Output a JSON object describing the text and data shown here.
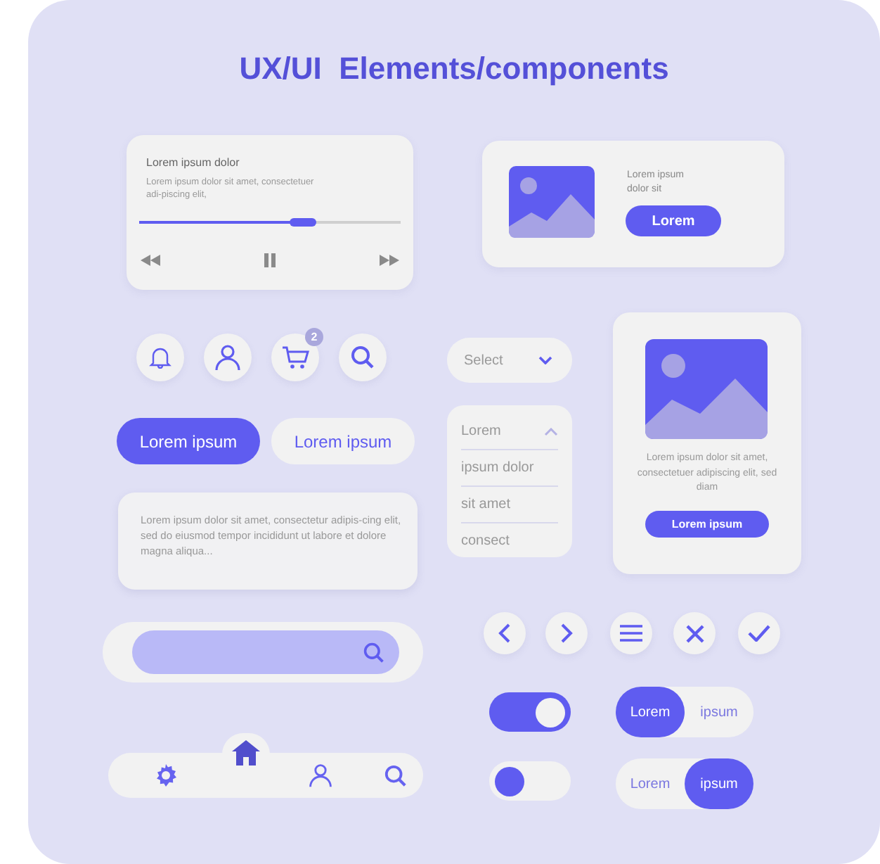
{
  "title": "UX/UI  Elements/components",
  "player": {
    "title": "Lorem ipsum dolor",
    "text": "Lorem ipsum dolor sit amet, consectetuer adi-piscing elit,",
    "level": 0.63
  },
  "media_card": {
    "text": "Lorem ipsum dolor sit",
    "button": "Lorem"
  },
  "cart_badge": "2",
  "buttons": [
    {
      "label": "Lorem ipsum",
      "kind": "primary"
    },
    {
      "label": "Lorem ipsum",
      "kind": "secondary"
    }
  ],
  "text_box": {
    "text": "Lorem ipsum dolor sit amet, consectetur adipis-cing elit, sed do eiusmod tempor incididunt ut labore et dolore magna aliqua..."
  },
  "select": {
    "placeholder": "Select"
  },
  "dropdown": {
    "header": "Lorem",
    "options": [
      "ipsum dolor",
      "sit amet",
      "consect"
    ]
  },
  "image_card": {
    "text": "Lorem ipsum dolor sit amet, consectetuer adipiscing elit, sed diam",
    "button": "Lorem ipsum"
  },
  "toggles": [
    {
      "on": true
    },
    {
      "on": false
    }
  ],
  "segmented": [
    {
      "options": [
        {
          "label": "Lorem",
          "selected": true
        },
        {
          "label": "ipsum",
          "selected": false
        }
      ]
    },
    {
      "options": [
        {
          "label": "Lorem",
          "selected": false
        },
        {
          "label": "ipsum",
          "selected": true
        }
      ]
    }
  ],
  "bottom_nav": {
    "items": [
      {
        "selected": false
      },
      {
        "selected": true
      },
      {
        "selected": false
      },
      {
        "selected": false
      }
    ]
  }
}
